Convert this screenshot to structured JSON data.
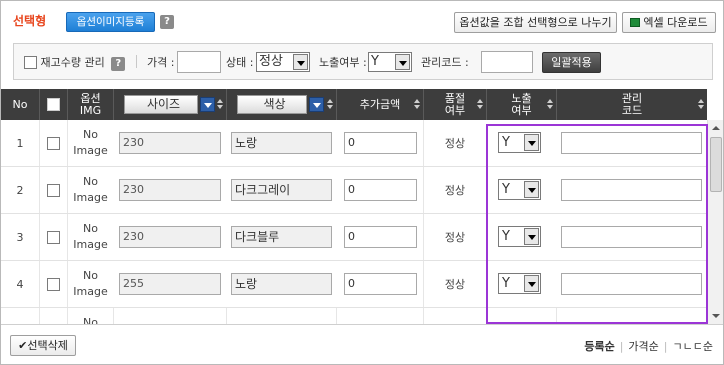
{
  "header": {
    "title": "선택형",
    "register_image_button": "옵션이미지등록",
    "help_label": "?",
    "split_button": "옵션값을 조합 선택형으로 나누기",
    "excel_button": "엑셀 다운로드"
  },
  "filters": {
    "stock_manage_label": "재고수량 관리",
    "price_label": "가격 :",
    "price_value": "",
    "status_label": "상태 :",
    "status_value": "정상",
    "exposure_label": "노출여부 :",
    "exposure_value": "Y",
    "code_label": "관리코드 :",
    "code_value": "",
    "apply_button": "일괄적용"
  },
  "table": {
    "headers": {
      "no": "No",
      "option_img": "옵션\nIMG",
      "size": "사이즈",
      "color": "색상",
      "extra_price": "추가금액",
      "stock_status": "품절\n여부",
      "exposure": "노출\n여부",
      "manage_code": "관리\n코드"
    },
    "no_image_text": "No\nImage",
    "rows": [
      {
        "no": "1",
        "size": "230",
        "color": "노랑",
        "price": "0",
        "status": "정상",
        "exposure": "Y",
        "code": ""
      },
      {
        "no": "2",
        "size": "230",
        "color": "다크그레이",
        "price": "0",
        "status": "정상",
        "exposure": "Y",
        "code": ""
      },
      {
        "no": "3",
        "size": "230",
        "color": "다크블루",
        "price": "0",
        "status": "정상",
        "exposure": "Y",
        "code": ""
      },
      {
        "no": "4",
        "size": "255",
        "color": "노랑",
        "price": "0",
        "status": "정상",
        "exposure": "Y",
        "code": ""
      },
      {
        "no": "",
        "size": "",
        "color": "",
        "price": "",
        "status": "",
        "exposure": "",
        "code": ""
      }
    ]
  },
  "footer": {
    "delete_button": "선택삭제",
    "sort_register": "등록순",
    "sort_price": "가격순",
    "sort_alpha": "ㄱㄴㄷ순"
  }
}
